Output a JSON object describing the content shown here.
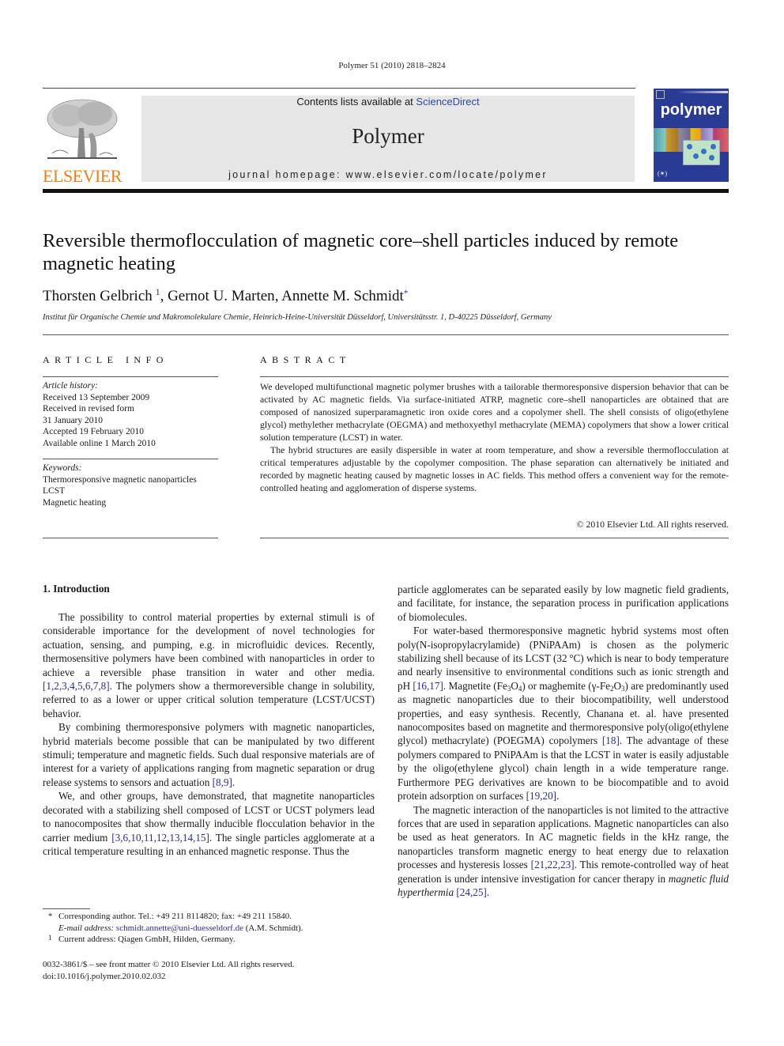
{
  "header": {
    "citation": "Polymer 51 (2010) 2818–2824",
    "contents_prefix": "Contents lists available at ",
    "contents_link": "ScienceDirect",
    "journal_name": "Polymer",
    "homepage": "journal homepage: www.elsevier.com/locate/polymer",
    "publisher_logo_text": "ELSEVIER",
    "cover_title": "polymer",
    "colors": {
      "elsevier_orange": "#f07f18",
      "link_blue": "#2b2b8f",
      "banner_gray": "#e6e6e6",
      "cover_blue": "#2a3b96"
    }
  },
  "article": {
    "title": "Reversible thermoflocculation of magnetic core–shell particles induced by remote magnetic heating",
    "authors": [
      {
        "name": "Thorsten Gelbrich",
        "mark": "1"
      },
      {
        "name": "Gernot U. Marten",
        "mark": ""
      },
      {
        "name": "Annette M. Schmidt",
        "mark": "*"
      }
    ],
    "affiliation": "Institut für Organische Chemie und Makromolekulare Chemie, Heinrich-Heine-Universität Düsseldorf, Universitätsstr. 1, D-40225 Düsseldorf, Germany"
  },
  "article_info": {
    "heading": "ARTICLE INFO",
    "history_label": "Article history:",
    "history": [
      "Received 13 September 2009",
      "Received in revised form",
      "31 January 2010",
      "Accepted 19 February 2010",
      "Available online 1 March 2010"
    ],
    "keywords_label": "Keywords:",
    "keywords": [
      "Thermoresponsive magnetic nanoparticles",
      "LCST",
      "Magnetic heating"
    ]
  },
  "abstract": {
    "heading": "ABSTRACT",
    "paragraphs": [
      "We developed multifunctional magnetic polymer brushes with a tailorable thermoresponsive dispersion behavior that can be activated by AC magnetic fields. Via surface-initiated ATRP, magnetic core–shell nanoparticles are obtained that are composed of nanosized superparamagnetic iron oxide cores and a copolymer shell. The shell consists of oligo(ethylene glycol) methylether methacrylate (OEGMA) and methoxyethyl methacrylate (MEMA) copolymers that show a lower critical solution temperature (LCST) in water.",
      "The hybrid structures are easily dispersible in water at room temperature, and show a reversible thermoflocculation at critical temperatures adjustable by the copolymer composition. The phase separation can alternatively be initiated and recorded by magnetic heating caused by magnetic losses in AC fields. This method offers a convenient way for the remote-controlled heating and agglomeration of disperse systems."
    ],
    "copyright": "© 2010 Elsevier Ltd. All rights reserved."
  },
  "intro": {
    "heading": "1.  Introduction",
    "left": {
      "p1_a": "The possibility to control material properties by external stimuli is of considerable importance for the development of novel technologies for actuation, sensing, and pumping, e.g. in microfluidic devices. Recently, thermosensitive polymers have been combined with nanoparticles in order to achieve a reversible phase transition in water and other media. ",
      "p1_ref": "[1,2,3,4,5,6,7,8]",
      "p1_b": ". The polymers show a thermoreversible change in solubility, referred to as a lower or upper critical solution temperature (LCST/UCST) behavior.",
      "p2_a": "By combining thermoresponsive polymers with magnetic nanoparticles, hybrid materials become possible that can be manipulated by two different stimuli; temperature and magnetic fields. Such dual responsive materials are of interest for a variety of applications ranging from magnetic separation or drug release systems to sensors and actuation ",
      "p2_ref": "[8,9]",
      "p2_b": ".",
      "p3_a": "We, and other groups, have demonstrated, that magnetite nanoparticles decorated with a stabilizing shell composed of LCST or UCST polymers lead to nanocomposites that show thermally inducible flocculation behavior in the carrier medium ",
      "p3_ref": "[3,6,10,11,12,13,14,15]",
      "p3_b": ". The single particles agglomerate at a critical temperature resulting in an enhanced magnetic response. Thus the"
    },
    "right": {
      "p0": "particle agglomerates can be separated easily by low magnetic field gradients, and facilitate, for instance, the separation process in purification applications of biomolecules.",
      "p1_a": "For water-based thermoresponsive magnetic hybrid systems most often poly(N-isopropylacrylamide) (PNiPAAm) is chosen as the polymeric stabilizing shell because of its LCST (32 °C) which is near to body temperature and nearly insensitive to environmental conditions such as ionic strength and pH ",
      "p1_ref1": "[16,17]",
      "p1_b": ". Magnetite (Fe",
      "p1_sub1": "3",
      "p1_c": "O",
      "p1_sub2": "4",
      "p1_d": ") or maghemite (γ-Fe",
      "p1_sub3": "2",
      "p1_e": "O",
      "p1_sub4": "3",
      "p1_f": ") are predominantly used as magnetic nanoparticles due to their biocompatibility, well understood properties, and easy synthesis. Recently, Chanana et. al. have presented nanocomposites based on magnetite and thermoresponsive poly(oligo(ethylene glycol) methacrylate) (POEGMA) copolymers ",
      "p1_ref2": "[18]",
      "p1_g": ". The advantage of these polymers compared to PNiPAAm is that the LCST in water is easily adjustable by the oligo(ethylene glycol) chain length in a wide temperature range. Furthermore PEG derivatives are known to be biocompatible and to avoid protein adsorption on surfaces ",
      "p1_ref3": "[19,20]",
      "p1_h": ".",
      "p2_a": "The magnetic interaction of the nanoparticles is not limited to the attractive forces that are used in separation applications. Magnetic nanoparticles can also be used as heat generators. In AC magnetic fields in the kHz range, the nanoparticles transform magnetic energy to heat energy due to relaxation processes and hysteresis losses ",
      "p2_ref1": "[21,22,23]",
      "p2_b": ". This remote-controlled way of heat generation is under intensive investigation for cancer therapy in ",
      "p2_em": "magnetic fluid hyperthermia",
      "p2_c": " ",
      "p2_ref2": "[24,25]",
      "p2_d": "."
    }
  },
  "footnotes": {
    "corr_mark": "*",
    "corr_text": "Corresponding author. Tel.: +49 211 8114820; fax: +49 211 15840.",
    "email_label": "E-mail address: ",
    "email": "schmidt.annette@uni-duesseldorf.de",
    "email_suffix": " (A.M. Schmidt).",
    "fn1_mark": "1",
    "fn1_text": "Current address: Qiagen GmbH, Hilden, Germany."
  },
  "footer": {
    "issn_line": "0032-3861/$ – see front matter © 2010 Elsevier Ltd. All rights reserved.",
    "doi": "doi:10.1016/j.polymer.2010.02.032"
  }
}
